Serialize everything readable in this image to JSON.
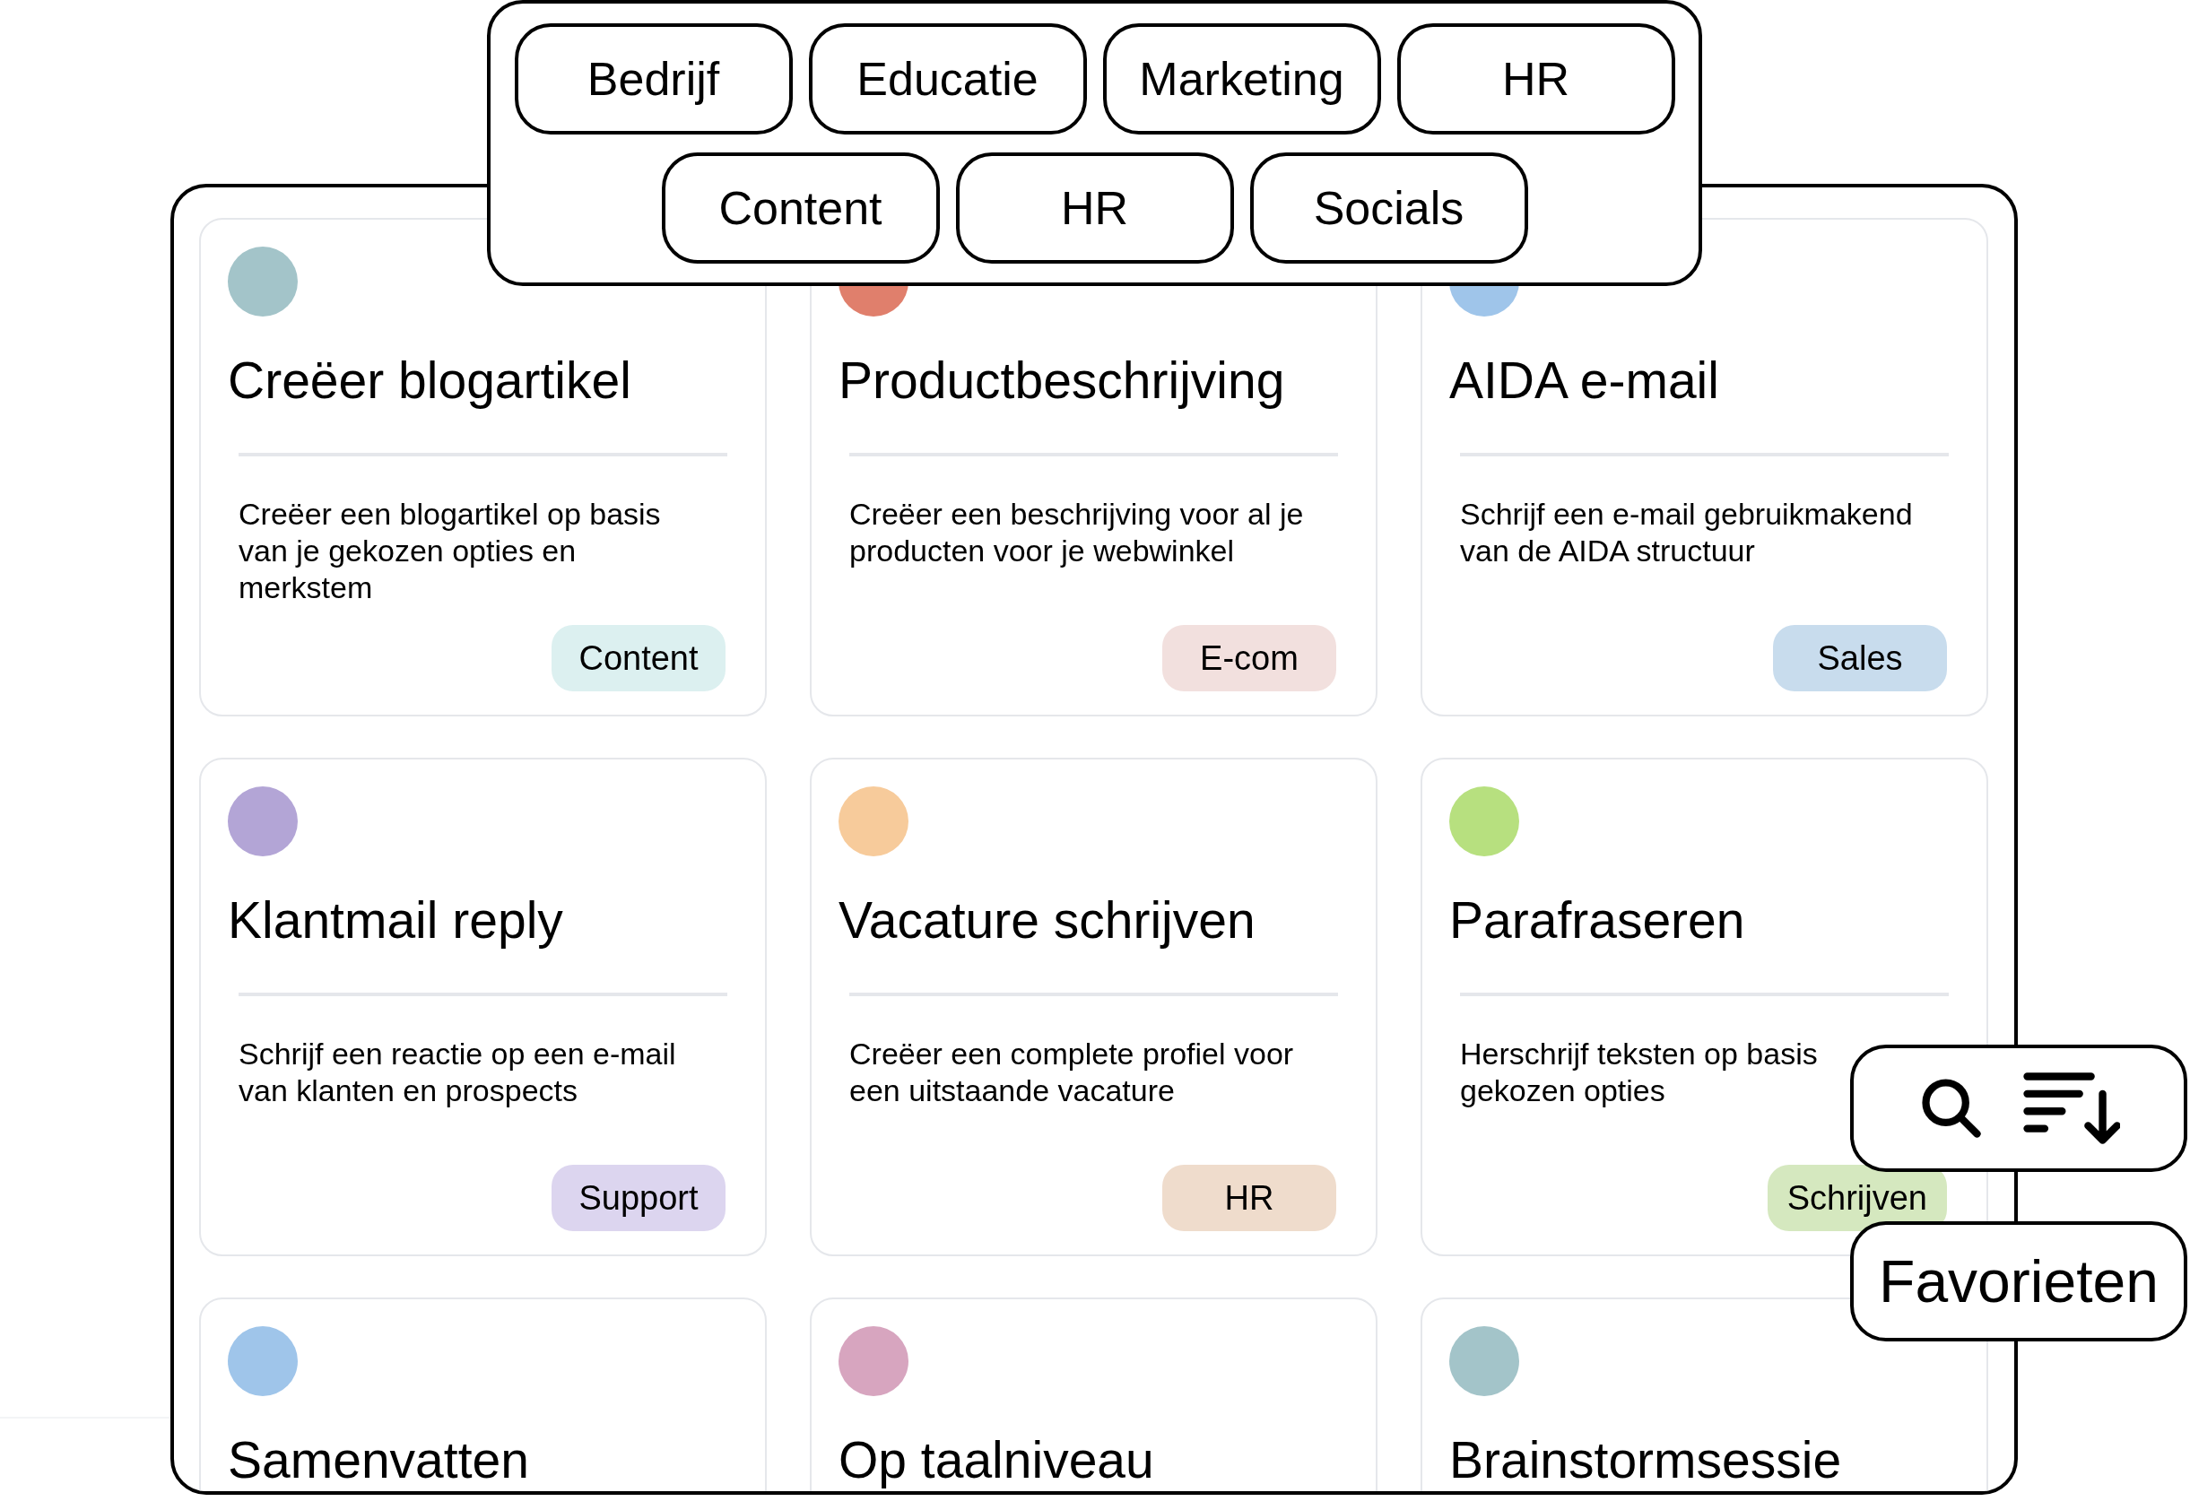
{
  "filters": [
    {
      "label": "Bedrijf"
    },
    {
      "label": "Educatie"
    },
    {
      "label": "Marketing"
    },
    {
      "label": "HR"
    },
    {
      "label": "Content"
    },
    {
      "label": "HR"
    },
    {
      "label": "Socials"
    }
  ],
  "cards": [
    {
      "title": "Creëer blogartikel",
      "description": "Creëer een blogartikel op basis van je gekozen opties en merkstem",
      "tag": {
        "label": "Content",
        "color": "#dcf0f0"
      },
      "color": "#a3c4c9"
    },
    {
      "title": "Productbeschrijving",
      "description": "Creëer een beschrijving voor al je producten voor je webwinkel",
      "tag": {
        "label": "E-com",
        "color": "#f2e0de"
      },
      "color": "#e07f6c"
    },
    {
      "title": "AIDA e-mail",
      "description": "Schrijf een e-mail gebruikmakend van de AIDA structuur",
      "tag": {
        "label": "Sales",
        "color": "#c8dced"
      },
      "color": "#9fc5ea"
    },
    {
      "title": "Klantmail reply",
      "description": "Schrijf een reactie op een e-mail van klanten en prospects",
      "tag": {
        "label": "Support",
        "color": "#dcd5ef"
      },
      "color": "#b3a5d6"
    },
    {
      "title": "Vacature schrijven",
      "description": "Creëer een complete profiel voor een uitstaande vacature",
      "tag": {
        "label": "HR",
        "color": "#efdccc"
      },
      "color": "#f7cb9b"
    },
    {
      "title": "Parafraseren",
      "description": "Herschrijf teksten op basis\ngekozen opties",
      "tag": {
        "label": "Schrijven",
        "color": "#d5e8bf"
      },
      "color": "#b7e07f"
    },
    {
      "title": "Samenvatten",
      "color": "#9fc5ea"
    },
    {
      "title": "Op taalniveau",
      "color": "#d7a5bf"
    },
    {
      "title": "Brainstormsessie",
      "color": "#a3c4c9"
    }
  ],
  "tools": {
    "favorites": "Favorieten"
  }
}
